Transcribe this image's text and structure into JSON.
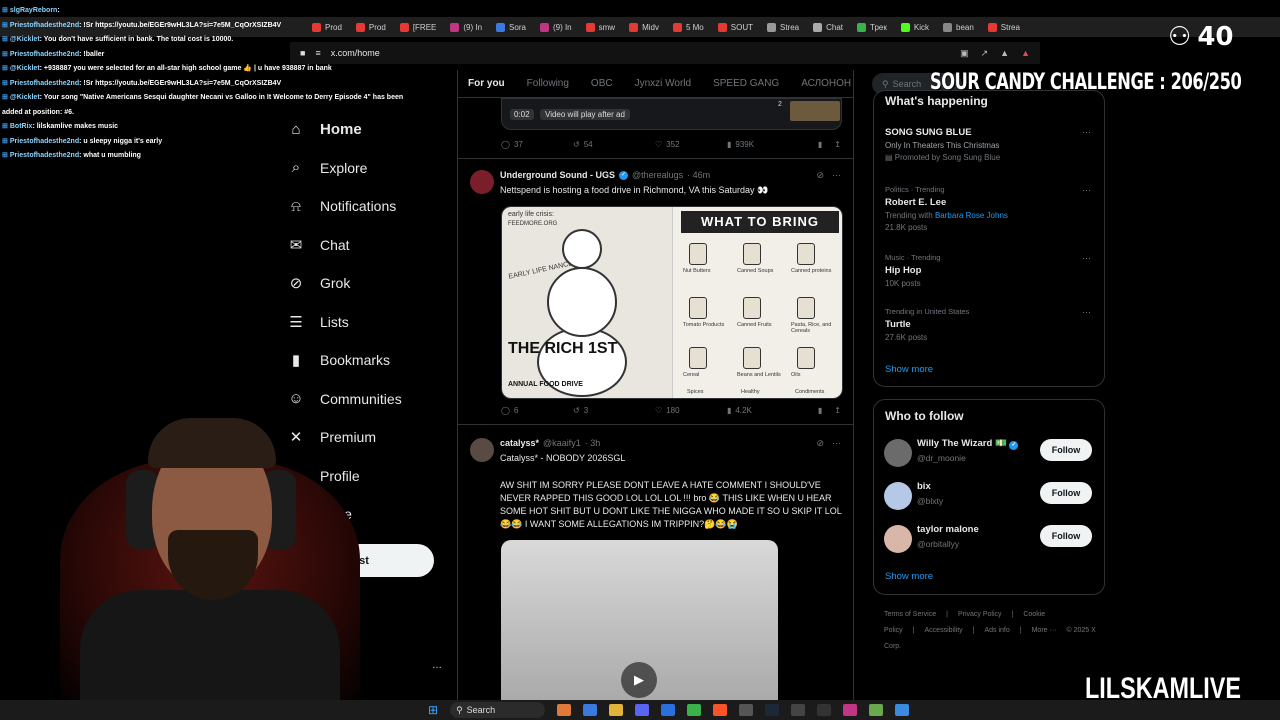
{
  "browser": {
    "url": "x.com/home",
    "tabs": [
      "Prod",
      "Prod",
      "[FREE",
      "(9) In",
      "Sora",
      "(9) In",
      "smw",
      "Midv",
      "5 Mo",
      "SOUT",
      "Strea",
      "Chat",
      "Трек",
      "Kick",
      "bean",
      "Strea"
    ]
  },
  "chat": {
    "messages": [
      {
        "user": "slgRayReborn",
        "text": ":"
      },
      {
        "user": "Priestofhadesthe2nd",
        "text": ": !Sr https://youtu.be/EGEr9wHL3LA?si=7e5M_CqOrXSIZB4V"
      },
      {
        "user": "@Kicklet",
        "text": ": You don't have sufficient in bank. The total cost is 10000."
      },
      {
        "user": "Priestofhadesthe2nd",
        "text": ": !baller"
      },
      {
        "user": "@Kicklet",
        "text": ": +938887 you were selected for an all-star high school game 👍 | u have 938887 in bank"
      },
      {
        "user": "Priestofhadesthe2nd",
        "text": ": !Sr https://youtu.be/EGEr9wHL3LA?si=7e5M_CqOrXSIZB4V"
      },
      {
        "user": "@Kicklet",
        "text": ": Your song \"Native Americans Sesqui daughter Necani vs Galloo in It Welcome to Derry Episode 4\" has been added at position: #6."
      },
      {
        "user": "BotRix",
        "text": ": lilskamlive makes music"
      },
      {
        "user": "Priestofhadesthe2nd",
        "text": ": u sleepy nigga it's early"
      },
      {
        "user": "Priestofhadesthe2nd",
        "text": ": what u mumbling"
      }
    ]
  },
  "nav": {
    "items": [
      {
        "label": "Home",
        "icon": "home-icon"
      },
      {
        "label": "Explore",
        "icon": "search-icon"
      },
      {
        "label": "Notifications",
        "icon": "bell-icon"
      },
      {
        "label": "Chat",
        "icon": "mail-icon"
      },
      {
        "label": "Grok",
        "icon": "grok-icon"
      },
      {
        "label": "Lists",
        "icon": "list-icon"
      },
      {
        "label": "Bookmarks",
        "icon": "bookmark-icon"
      },
      {
        "label": "Communities",
        "icon": "people-icon"
      },
      {
        "label": "Premium",
        "icon": "x-icon"
      },
      {
        "label": "Profile",
        "icon": "person-icon"
      },
      {
        "label": "More",
        "icon": "more-icon"
      }
    ],
    "post_label": "Post"
  },
  "feed": {
    "tabs": [
      "For you",
      "Following",
      "OBC",
      "Jynxzi World",
      "SPEED GANG",
      "АСЛОНОН"
    ],
    "top_video": {
      "time": "0:02",
      "note": "Video will play after ad",
      "count": "2"
    },
    "top_actions": {
      "replies": "37",
      "reposts": "54",
      "likes": "352",
      "views": "939K"
    },
    "post1": {
      "name": "Underground Sound - UGS",
      "handle": "@therealugs",
      "age": "· 46m",
      "text": "Nettspend is hosting a food drive in Richmond, VA this Saturday 👀",
      "flyer_left_top": "early life crisis:",
      "flyer_site": "FEEDMORE.ORG",
      "flyer_early": "EARLY LIFE NANCE",
      "flyer_big": "THE RICH 1ST",
      "flyer_sub": "ANNUAL FOOD DRIVE",
      "flyer_right_title": "WHAT TO BRING",
      "flyer_items": [
        "Nut Butters",
        "Canned Soups",
        "Canned proteins",
        "Tomato Products",
        "Canned Fruits",
        "Pasta, Rice, and Cereals",
        "Cereal",
        "Beans and Lentils",
        "Oils",
        "Spices",
        "Healthy",
        "Condiments"
      ],
      "replies": "6",
      "reposts": "3",
      "likes": "180",
      "views": "4.2K"
    },
    "post2": {
      "name": "catalyss*",
      "handle": "@kaaify1",
      "age": "· 3h",
      "line1": "Catalyss* - NOBODY 2026SGL",
      "body": "AW SHIT IM SORRY PLEASE DONT LEAVE A HATE COMMENT I SHOULD'VE NEVER RAPPED THIS GOOD LOL LOL LOL !!! bro 😂 THIS LIKE WHEN U HEAR SOME HOT SHIT BUT U DONT LIKE THE NIGGA WHO MADE IT SO U SKIP IT LOL 😂😂 I WANT SOME ALLEGATIONS  IM TRIPPIN?🤔😂😭"
    }
  },
  "sidebar": {
    "search_placeholder": "Search",
    "happening_title": "What's happening",
    "trends": [
      {
        "category": "",
        "title": "SONG SUNG BLUE",
        "meta": "Only In Theaters This Christmas",
        "meta2": "Promoted by Song Sung Blue"
      },
      {
        "category": "Politics · Trending",
        "title": "Robert E. Lee",
        "meta": "Trending with",
        "link": "Barbara Rose Johns",
        "meta2": "21.8K posts"
      },
      {
        "category": "Music · Trending",
        "title": "Hip Hop",
        "meta": "10K posts"
      },
      {
        "category": "Trending in United States",
        "title": "Turtle",
        "meta": "27.6K posts"
      }
    ],
    "show_more": "Show more",
    "who_to_follow": {
      "title": "Who to follow",
      "accounts": [
        {
          "name": "Willy The Wizard 💵",
          "handle": "@dr_moonie"
        },
        {
          "name": "bix",
          "handle": "@blxty"
        },
        {
          "name": "taylor malone",
          "handle": "@orbitallyy"
        }
      ],
      "follow_label": "Follow",
      "show_more": "Show more"
    },
    "footer": [
      "Terms of Service",
      "|",
      "Privacy Policy",
      "|",
      "Cookie Policy",
      "|",
      "Accessibility",
      "|",
      "Ads info",
      "|",
      "More ···",
      "© 2025 X Corp."
    ]
  },
  "overlay": {
    "viewers": "40",
    "challenge": "SOUR CANDY CHALLENGE : 206/250",
    "brand": "LILSKAMLIVE"
  },
  "taskbar": {
    "search": "Search"
  },
  "colors": {
    "accent": "#1d9bf0",
    "background": "#000000"
  }
}
